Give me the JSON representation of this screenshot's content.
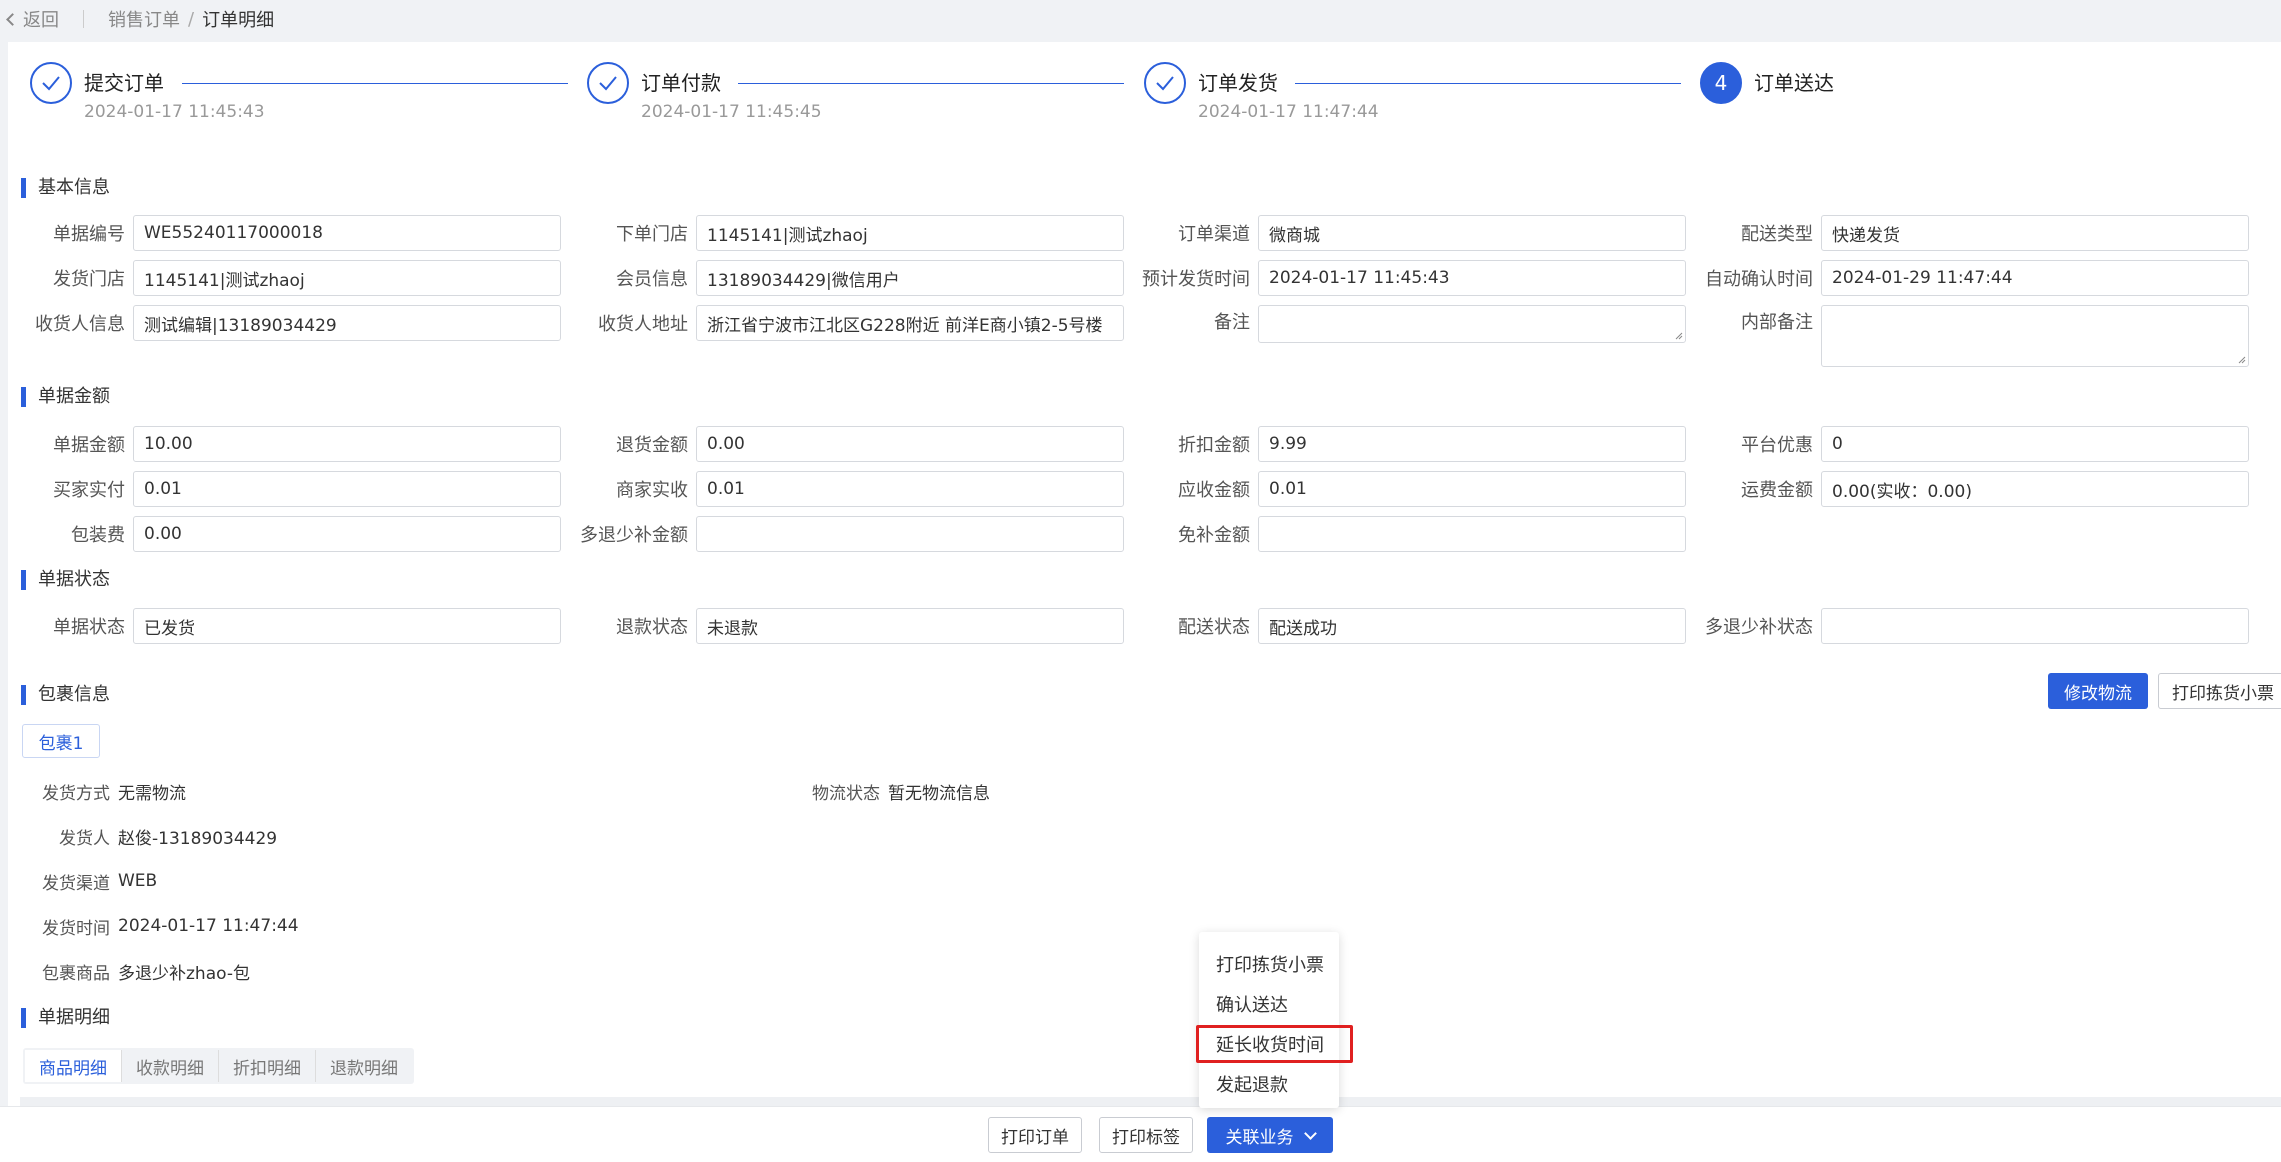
{
  "topbar": {
    "back_label": "返回",
    "breadcrumb_parent": "销售订单",
    "breadcrumb_separator": "/",
    "breadcrumb_current": "订单明细"
  },
  "steps": [
    {
      "icon": "check-icon",
      "label": "提交订单",
      "time": "2024-01-17 11:45:43"
    },
    {
      "icon": "check-icon",
      "label": "订单付款",
      "time": "2024-01-17 11:45:45"
    },
    {
      "icon": "check-icon",
      "label": "订单发货",
      "time": "2024-01-17 11:47:44"
    },
    {
      "number": "4",
      "label": "订单送达",
      "time": ""
    }
  ],
  "basic": {
    "title": "基本信息",
    "doc_no_label": "单据编号",
    "doc_no": "WE55240117000018",
    "order_store_label": "下单门店",
    "order_store": "1145141|测试zhaoj",
    "channel_label": "订单渠道",
    "channel": "微商城",
    "delivery_type_label": "配送类型",
    "delivery_type": "快递发货",
    "ship_store_label": "发货门店",
    "ship_store": "1145141|测试zhaoj",
    "member_label": "会员信息",
    "member": "13189034429|微信用户",
    "est_ship_label": "预计发货时间",
    "est_ship": "2024-01-17 11:45:43",
    "auto_confirm_label": "自动确认时间",
    "auto_confirm": "2024-01-29 11:47:44",
    "receiver_label": "收货人信息",
    "receiver": "测试编辑|13189034429",
    "address_label": "收货人地址",
    "address": "浙江省宁波市江北区G228附近 前洋E商小镇2-5号楼",
    "remark_label": "备注",
    "remark": "",
    "internal_remark_label": "内部备注",
    "internal_remark": ""
  },
  "amount": {
    "title": "单据金额",
    "doc_amount_label": "单据金额",
    "doc_amount": "10.00",
    "return_amount_label": "退货金额",
    "return_amount": "0.00",
    "discount_label": "折扣金额",
    "discount": "9.99",
    "platform_label": "平台优惠",
    "platform": "0",
    "buyer_paid_label": "买家实付",
    "buyer_paid": "0.01",
    "merchant_recv_label": "商家实收",
    "merchant_recv": "0.01",
    "receivable_label": "应收金额",
    "receivable": "0.01",
    "freight_label": "运费金额",
    "freight": "0.00(实收：0.00)",
    "packing_label": "包装费",
    "packing": "0.00",
    "refund_diff_label": "多退少补金额",
    "refund_diff": "",
    "exempt_label": "免补金额",
    "exempt": ""
  },
  "status": {
    "title": "单据状态",
    "doc_status_label": "单据状态",
    "doc_status": "已发货",
    "refund_status_label": "退款状态",
    "refund_status": "未退款",
    "delivery_status_label": "配送状态",
    "delivery_status": "配送成功",
    "diff_status_label": "多退少补状态",
    "diff_status": ""
  },
  "package": {
    "title": "包裹信息",
    "modify_logistics_btn": "修改物流",
    "print_pick_btn": "打印拣货小票",
    "tab": "包裹1",
    "ship_method_label": "发货方式",
    "ship_method": "无需物流",
    "logistics_status_label": "物流状态",
    "logistics_status": "暂无物流信息",
    "shipper_label": "发货人",
    "shipper": "赵俊-13189034429",
    "ship_channel_label": "发货渠道",
    "ship_channel": "WEB",
    "ship_time_label": "发货时间",
    "ship_time": "2024-01-17 11:47:44",
    "goods_label": "包裹商品",
    "goods": "多退少补zhao-包"
  },
  "detail": {
    "title": "单据明细",
    "tabs": [
      "商品明细",
      "收款明细",
      "折扣明细",
      "退款明细"
    ]
  },
  "footer": {
    "print_order": "打印订单",
    "print_label": "打印标签",
    "related": "关联业务"
  },
  "dropdown": {
    "items": [
      "打印拣货小票",
      "确认送达",
      "延长收货时间",
      "发起退款"
    ]
  },
  "colors": {
    "accent": "#2b5fdb",
    "highlight": "#e02020"
  }
}
